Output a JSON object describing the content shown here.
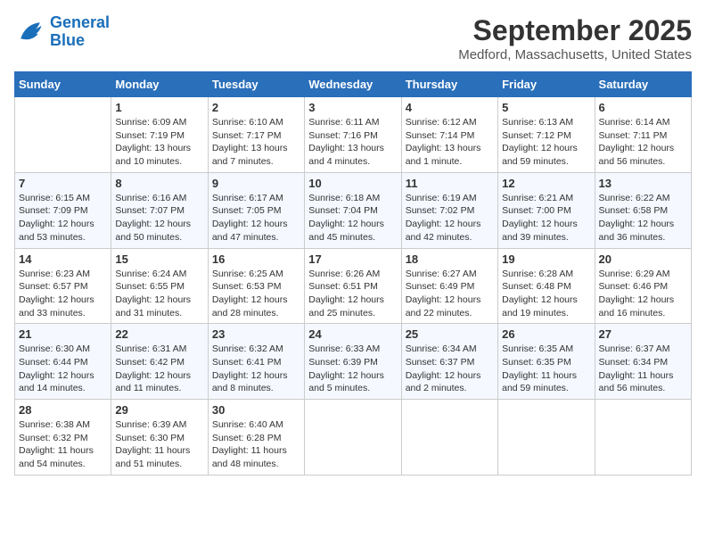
{
  "logo": {
    "line1": "General",
    "line2": "Blue"
  },
  "title": "September 2025",
  "location": "Medford, Massachusetts, United States",
  "days_of_week": [
    "Sunday",
    "Monday",
    "Tuesday",
    "Wednesday",
    "Thursday",
    "Friday",
    "Saturday"
  ],
  "weeks": [
    [
      {
        "day": "",
        "info": ""
      },
      {
        "day": "1",
        "info": "Sunrise: 6:09 AM\nSunset: 7:19 PM\nDaylight: 13 hours\nand 10 minutes."
      },
      {
        "day": "2",
        "info": "Sunrise: 6:10 AM\nSunset: 7:17 PM\nDaylight: 13 hours\nand 7 minutes."
      },
      {
        "day": "3",
        "info": "Sunrise: 6:11 AM\nSunset: 7:16 PM\nDaylight: 13 hours\nand 4 minutes."
      },
      {
        "day": "4",
        "info": "Sunrise: 6:12 AM\nSunset: 7:14 PM\nDaylight: 13 hours\nand 1 minute."
      },
      {
        "day": "5",
        "info": "Sunrise: 6:13 AM\nSunset: 7:12 PM\nDaylight: 12 hours\nand 59 minutes."
      },
      {
        "day": "6",
        "info": "Sunrise: 6:14 AM\nSunset: 7:11 PM\nDaylight: 12 hours\nand 56 minutes."
      }
    ],
    [
      {
        "day": "7",
        "info": "Sunrise: 6:15 AM\nSunset: 7:09 PM\nDaylight: 12 hours\nand 53 minutes."
      },
      {
        "day": "8",
        "info": "Sunrise: 6:16 AM\nSunset: 7:07 PM\nDaylight: 12 hours\nand 50 minutes."
      },
      {
        "day": "9",
        "info": "Sunrise: 6:17 AM\nSunset: 7:05 PM\nDaylight: 12 hours\nand 47 minutes."
      },
      {
        "day": "10",
        "info": "Sunrise: 6:18 AM\nSunset: 7:04 PM\nDaylight: 12 hours\nand 45 minutes."
      },
      {
        "day": "11",
        "info": "Sunrise: 6:19 AM\nSunset: 7:02 PM\nDaylight: 12 hours\nand 42 minutes."
      },
      {
        "day": "12",
        "info": "Sunrise: 6:21 AM\nSunset: 7:00 PM\nDaylight: 12 hours\nand 39 minutes."
      },
      {
        "day": "13",
        "info": "Sunrise: 6:22 AM\nSunset: 6:58 PM\nDaylight: 12 hours\nand 36 minutes."
      }
    ],
    [
      {
        "day": "14",
        "info": "Sunrise: 6:23 AM\nSunset: 6:57 PM\nDaylight: 12 hours\nand 33 minutes."
      },
      {
        "day": "15",
        "info": "Sunrise: 6:24 AM\nSunset: 6:55 PM\nDaylight: 12 hours\nand 31 minutes."
      },
      {
        "day": "16",
        "info": "Sunrise: 6:25 AM\nSunset: 6:53 PM\nDaylight: 12 hours\nand 28 minutes."
      },
      {
        "day": "17",
        "info": "Sunrise: 6:26 AM\nSunset: 6:51 PM\nDaylight: 12 hours\nand 25 minutes."
      },
      {
        "day": "18",
        "info": "Sunrise: 6:27 AM\nSunset: 6:49 PM\nDaylight: 12 hours\nand 22 minutes."
      },
      {
        "day": "19",
        "info": "Sunrise: 6:28 AM\nSunset: 6:48 PM\nDaylight: 12 hours\nand 19 minutes."
      },
      {
        "day": "20",
        "info": "Sunrise: 6:29 AM\nSunset: 6:46 PM\nDaylight: 12 hours\nand 16 minutes."
      }
    ],
    [
      {
        "day": "21",
        "info": "Sunrise: 6:30 AM\nSunset: 6:44 PM\nDaylight: 12 hours\nand 14 minutes."
      },
      {
        "day": "22",
        "info": "Sunrise: 6:31 AM\nSunset: 6:42 PM\nDaylight: 12 hours\nand 11 minutes."
      },
      {
        "day": "23",
        "info": "Sunrise: 6:32 AM\nSunset: 6:41 PM\nDaylight: 12 hours\nand 8 minutes."
      },
      {
        "day": "24",
        "info": "Sunrise: 6:33 AM\nSunset: 6:39 PM\nDaylight: 12 hours\nand 5 minutes."
      },
      {
        "day": "25",
        "info": "Sunrise: 6:34 AM\nSunset: 6:37 PM\nDaylight: 12 hours\nand 2 minutes."
      },
      {
        "day": "26",
        "info": "Sunrise: 6:35 AM\nSunset: 6:35 PM\nDaylight: 11 hours\nand 59 minutes."
      },
      {
        "day": "27",
        "info": "Sunrise: 6:37 AM\nSunset: 6:34 PM\nDaylight: 11 hours\nand 56 minutes."
      }
    ],
    [
      {
        "day": "28",
        "info": "Sunrise: 6:38 AM\nSunset: 6:32 PM\nDaylight: 11 hours\nand 54 minutes."
      },
      {
        "day": "29",
        "info": "Sunrise: 6:39 AM\nSunset: 6:30 PM\nDaylight: 11 hours\nand 51 minutes."
      },
      {
        "day": "30",
        "info": "Sunrise: 6:40 AM\nSunset: 6:28 PM\nDaylight: 11 hours\nand 48 minutes."
      },
      {
        "day": "",
        "info": ""
      },
      {
        "day": "",
        "info": ""
      },
      {
        "day": "",
        "info": ""
      },
      {
        "day": "",
        "info": ""
      }
    ]
  ]
}
